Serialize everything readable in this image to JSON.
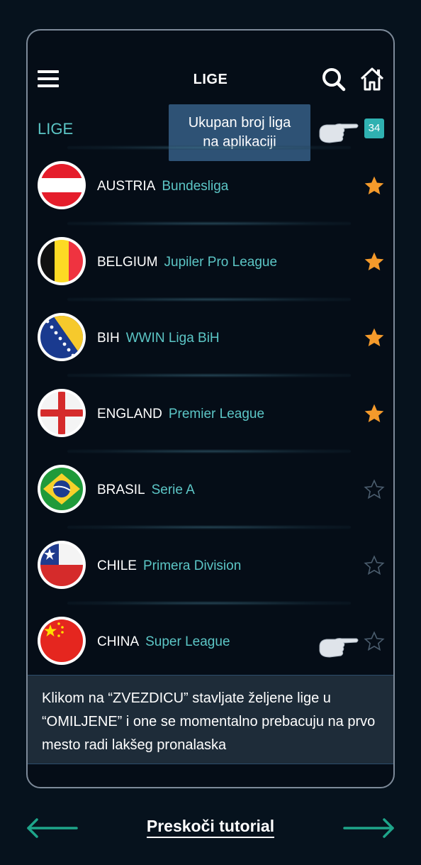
{
  "header": {
    "title": "LIGE",
    "icons": [
      "menu-icon",
      "search-icon",
      "home-icon"
    ]
  },
  "section": {
    "label": "LIGE",
    "count": "34"
  },
  "tooltip": {
    "line1": "Ukupan broj liga",
    "line2": "na aplikaciji"
  },
  "leagues": [
    {
      "country": "AUSTRIA",
      "league": "Bundesliga",
      "favorite": true,
      "flag": "austria-flag"
    },
    {
      "country": "BELGIUM",
      "league": "Jupiler Pro League",
      "favorite": true,
      "flag": "belgium-flag"
    },
    {
      "country": "BIH",
      "league": "WWIN Liga BiH",
      "favorite": true,
      "flag": "bih-flag"
    },
    {
      "country": "ENGLAND",
      "league": "Premier League",
      "favorite": true,
      "flag": "england-flag"
    },
    {
      "country": "BRASIL",
      "league": "Serie A",
      "favorite": false,
      "flag": "brasil-flag"
    },
    {
      "country": "CHILE",
      "league": "Primera Division",
      "favorite": false,
      "flag": "chile-flag"
    },
    {
      "country": "CHINA",
      "league": "Super League",
      "favorite": false,
      "flag": "china-flag"
    }
  ],
  "hint": {
    "text": "Klikom na “ZVEZDICU” stavljate željene lige u “OMILJENE” i one se momentalno prebacuju na prvo mesto radi lakšeg pronalaska"
  },
  "footer": {
    "skip_label": "Preskoči tutorial"
  },
  "colors": {
    "background": "#06121d",
    "accent": "#5cc6c6",
    "badge": "#2fb1b1",
    "star_active": "#f49a2b",
    "tooltip": "#2e5275",
    "footer_arrow": "#1ea58a"
  }
}
